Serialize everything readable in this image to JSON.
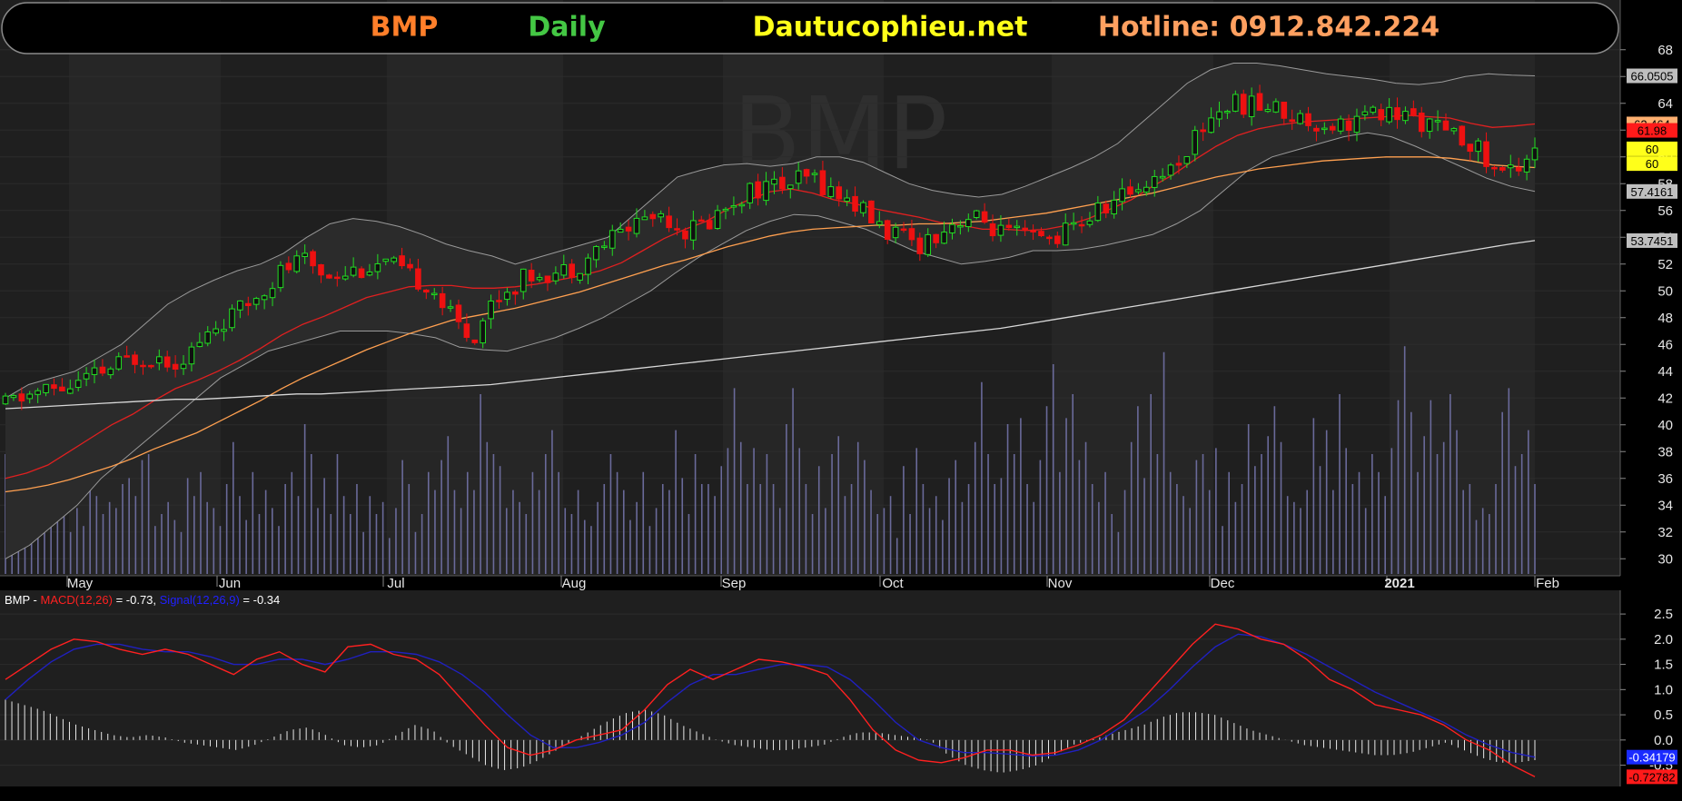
{
  "header": {
    "symbol": "BMP",
    "period": "Daily",
    "site": "Dautucophieu.net",
    "hotline": "Hotline: 0912.842.224",
    "colors": {
      "symbol": "#ff7f2a",
      "period": "#44c744",
      "site": "#ffff1a",
      "hotline": "#ffa060"
    }
  },
  "watermark": "BMP",
  "chart_data": [
    {
      "type": "candlestick",
      "title": "BMP",
      "y_ticks": [
        "30",
        "32",
        "34",
        "36",
        "38",
        "40",
        "42",
        "44",
        "46",
        "48",
        "50",
        "52",
        "54",
        "56",
        "58",
        "60",
        "62",
        "64",
        "66",
        "68"
      ],
      "ylim": [
        29,
        69
      ],
      "month_labels": [
        "May",
        "Jun",
        "Jul",
        "Aug",
        "Sep",
        "Oct",
        "Nov",
        "Dec",
        "2021",
        "Feb"
      ],
      "value_labels": [
        {
          "text": "66.0505",
          "value": 66.05,
          "bg": "#bfbfbf",
          "fg": "#000000"
        },
        {
          "text": "62.464",
          "value": 62.46,
          "bg": "#ffb070",
          "fg": "#000000"
        },
        {
          "text": "61.98",
          "value": 61.98,
          "bg": "#ff1a1a",
          "fg": "#000000"
        },
        {
          "text": "60",
          "value": 60.6,
          "bg": "#ffff1a",
          "fg": "#000000"
        },
        {
          "text": "60",
          "value": 59.5,
          "bg": "#ffff1a",
          "fg": "#000000"
        },
        {
          "text": "57.4161",
          "value": 57.42,
          "bg": "#bfbfbf",
          "fg": "#000000"
        },
        {
          "text": "53.7451",
          "value": 53.75,
          "bg": "#bfbfbf",
          "fg": "#000000"
        }
      ],
      "trend": [
        41.5,
        42.2,
        42.6,
        42.8,
        43.5,
        44.2,
        45.0,
        45.2,
        44.8,
        45.8,
        47.5,
        48.4,
        50.0,
        51.5,
        52.3,
        51.3,
        51.5,
        51.8,
        52.0,
        51.0,
        50.5,
        48.0,
        46.5,
        49.5,
        50.5,
        51.5,
        51.3,
        52.0,
        53.3,
        54.5,
        55.5,
        55.8,
        54.5,
        55.0,
        56.5,
        57.5,
        57.8,
        58.0,
        58.5,
        57.3,
        56.5,
        55.0,
        54.0,
        53.5,
        54.5,
        55.5,
        55.2,
        54.2,
        54.0,
        53.8,
        54.5,
        55.5,
        56.5,
        57.5,
        58.5,
        59.3,
        61.5,
        63.5,
        64.0,
        63.8,
        63.5,
        62.8,
        62.5,
        62.5,
        63.0,
        63.2,
        63.0,
        62.5,
        61.5,
        61.2,
        59.0,
        59.0,
        61.0
      ],
      "series": [
        {
          "name": "MA20",
          "color": "#e02020",
          "values": [
            36,
            36.4,
            37,
            38,
            39,
            40,
            40.8,
            41.8,
            42.7,
            43.3,
            44,
            44.8,
            45.7,
            46.7,
            47.5,
            48.1,
            48.8,
            49.5,
            49.9,
            50.3,
            50.4,
            50.4,
            50.2,
            50.2,
            50.3,
            50.5,
            50.8,
            51.1,
            51.5,
            52.1,
            53,
            53.9,
            54.6,
            55.2,
            56.1,
            56.8,
            57.4,
            57.6,
            57.3,
            56.8,
            56.5,
            56.1,
            55.8,
            55.5,
            55.1,
            54.9,
            54.6,
            54.6,
            54.5,
            54.6,
            54.9,
            55.4,
            56.1,
            56.8,
            57.8,
            58.7,
            59.8,
            60.8,
            61.6,
            62.1,
            62.4,
            62.6,
            62.7,
            62.8,
            62.9,
            63,
            63.1,
            63,
            62.9,
            62.5,
            62.2,
            62.3,
            62.46
          ]
        },
        {
          "name": "MA50",
          "color": "#ffa050",
          "values": [
            35,
            35.2,
            35.5,
            35.9,
            36.4,
            36.9,
            37.5,
            38.2,
            38.8,
            39.4,
            40.2,
            41,
            41.8,
            42.7,
            43.5,
            44.2,
            44.9,
            45.6,
            46.2,
            46.8,
            47.3,
            47.8,
            48.1,
            48.4,
            48.7,
            49.1,
            49.5,
            49.9,
            50.4,
            50.9,
            51.4,
            51.9,
            52.3,
            52.8,
            53.3,
            53.7,
            54.1,
            54.4,
            54.6,
            54.7,
            54.8,
            54.9,
            54.9,
            55,
            55,
            55.1,
            55.2,
            55.4,
            55.6,
            55.8,
            56.1,
            56.4,
            56.7,
            57,
            57.3,
            57.7,
            58.1,
            58.5,
            58.8,
            59.1,
            59.3,
            59.5,
            59.7,
            59.8,
            59.9,
            60,
            60,
            60,
            59.9,
            59.7,
            59.4,
            59.3,
            59.2
          ]
        },
        {
          "name": "MA200",
          "color": "#d8d8d8",
          "values": [
            41.2,
            41.3,
            41.4,
            41.5,
            41.6,
            41.7,
            41.8,
            41.9,
            41.9,
            42,
            42.1,
            42.2,
            42.3,
            42.3,
            42.4,
            42.5,
            42.6,
            42.7,
            42.8,
            42.9,
            43,
            43.2,
            43.4,
            43.6,
            43.8,
            44,
            44.2,
            44.4,
            44.6,
            44.8,
            45,
            45.2,
            45.4,
            45.6,
            45.8,
            46,
            46.2,
            46.4,
            46.6,
            46.8,
            47,
            47.2,
            47.5,
            47.8,
            48.1,
            48.4,
            48.7,
            49,
            49.3,
            49.6,
            49.9,
            50.2,
            50.5,
            50.8,
            51.1,
            51.4,
            51.7,
            52,
            52.3,
            52.6,
            52.9,
            53.2,
            53.5,
            53.75
          ]
        }
      ],
      "bollinger": {
        "color": "#9a9a9a",
        "upper": [
          42,
          43,
          43.5,
          44,
          45,
          46,
          47.5,
          49,
          50,
          50.8,
          51.5,
          52,
          52.8,
          54,
          55,
          55.4,
          55.2,
          54.8,
          54.2,
          53.5,
          53,
          52.6,
          52,
          52.5,
          53,
          53.5,
          54,
          55.5,
          57,
          58.5,
          59,
          59.4,
          59.5,
          59.3,
          59.5,
          60,
          60,
          59.6,
          58.8,
          58,
          57.5,
          57.2,
          57,
          57.2,
          57.8,
          58.5,
          59.2,
          60,
          61,
          62.5,
          64,
          65.5,
          66.5,
          67,
          67,
          66.8,
          66.5,
          66.2,
          66,
          65.8,
          65.5,
          65.4,
          65.6,
          66,
          66.2,
          66.1,
          66.05
        ],
        "lower": [
          30,
          31,
          32.5,
          34,
          36,
          37.5,
          39,
          40.5,
          42,
          43.5,
          44.5,
          45.5,
          46,
          46.5,
          47,
          47,
          47,
          46.8,
          46.5,
          45.8,
          45.6,
          45.5,
          46,
          46.5,
          47.2,
          48,
          49,
          50,
          51.3,
          52.5,
          53.5,
          54.5,
          55.2,
          55.7,
          55.6,
          55.1,
          54.6,
          53.8,
          53,
          52.5,
          52,
          52.2,
          52.5,
          53,
          53,
          53.1,
          53.4,
          53.8,
          54.2,
          55,
          56,
          57.5,
          59,
          60,
          60.5,
          61,
          61.5,
          61.8,
          61.5,
          60.8,
          60,
          59.2,
          58.4,
          57.8,
          57.42
        ]
      }
    },
    {
      "type": "bar",
      "title": "Volume",
      "ylim": [
        0,
        100
      ],
      "values": [
        40,
        22,
        38,
        30,
        18,
        26,
        36,
        30,
        42,
        28,
        14,
        22,
        16,
        30,
        26,
        20,
        24,
        22,
        30,
        32,
        26,
        38,
        40,
        16,
        20,
        24,
        18,
        14,
        32,
        26,
        34,
        24,
        22,
        16,
        30,
        44,
        26,
        18,
        34,
        20,
        28,
        22,
        16,
        30,
        34,
        26,
        50,
        40,
        22,
        32,
        20,
        40,
        26,
        20,
        30,
        14,
        26,
        20,
        24,
        12,
        22,
        38,
        30,
        14,
        20,
        34,
        28,
        38,
        46,
        28,
        22,
        34,
        28,
        60,
        44,
        40,
        36,
        22,
        28,
        24,
        20,
        34,
        28,
        40,
        48,
        34,
        22,
        20,
        28,
        18,
        16,
        24,
        30,
        40,
        34,
        28,
        18,
        24,
        34,
        16,
        22,
        30,
        28,
        48,
        32,
        20,
        40,
        30,
        30,
        26,
        36,
        42,
        62,
        44,
        30,
        42,
        30,
        40,
        30,
        22,
        50,
        62,
        42,
        30,
        20,
        36,
        22,
        40,
        46,
        26,
        30,
        44,
        38,
        28,
        20,
        22,
        26,
        12,
        36,
        20,
        42,
        30,
        22,
        26,
        18,
        32,
        38,
        24,
        30,
        44,
        64,
        40,
        30,
        32,
        50,
        40,
        52,
        30,
        24,
        38,
        56,
        70,
        34,
        52,
        60,
        38,
        44,
        30,
        24,
        34,
        20,
        14,
        28,
        44,
        56,
        32,
        60,
        40,
        74,
        34,
        30,
        26,
        22,
        38,
        40,
        28,
        42,
        16,
        34,
        24,
        30,
        50,
        36,
        40,
        46,
        56,
        44,
        26,
        24,
        22,
        28,
        52,
        36,
        48,
        28,
        60,
        42,
        30,
        34,
        22,
        40,
        34,
        26,
        42,
        58,
        76,
        54,
        34,
        46,
        58,
        40,
        44,
        60,
        48,
        28,
        30,
        18,
        22,
        20,
        30,
        54,
        62,
        36,
        40,
        48,
        30
      ]
    },
    {
      "type": "line",
      "title": "MACD",
      "legend": {
        "prefix": "BMP - ",
        "macd_label": "MACD(12,26)",
        "macd_value": " = -0.73, ",
        "signal_label": "Signal(12,26,9)",
        "signal_value": " = -0.34"
      },
      "y_ticks": [
        "2.5",
        "2.0",
        "1.5",
        "1.0",
        "0.5",
        "0.0",
        "-0.5"
      ],
      "ylim": [
        -0.85,
        2.7
      ],
      "value_labels": [
        {
          "text": "-0.34179",
          "value": -0.34,
          "bg": "#1a2bff",
          "fg": "#ffffff"
        },
        {
          "text": "-0.72782",
          "value": -0.73,
          "bg": "#ff1a1a",
          "fg": "#000000"
        }
      ],
      "series": [
        {
          "name": "MACD",
          "color": "#ff2020",
          "values": [
            1.2,
            1.5,
            1.8,
            2.0,
            1.95,
            1.8,
            1.7,
            1.8,
            1.7,
            1.5,
            1.3,
            1.6,
            1.75,
            1.5,
            1.35,
            1.85,
            1.9,
            1.7,
            1.6,
            1.3,
            0.8,
            0.3,
            -0.15,
            -0.3,
            -0.2,
            0.0,
            0.1,
            0.2,
            0.6,
            1.1,
            1.4,
            1.2,
            1.4,
            1.6,
            1.55,
            1.45,
            1.3,
            0.8,
            0.2,
            -0.2,
            -0.4,
            -0.45,
            -0.35,
            -0.2,
            -0.2,
            -0.3,
            -0.25,
            -0.1,
            0.1,
            0.4,
            0.9,
            1.4,
            1.9,
            2.3,
            2.2,
            2.0,
            1.9,
            1.6,
            1.2,
            1.0,
            0.7,
            0.6,
            0.5,
            0.3,
            0.0,
            -0.2,
            -0.5,
            -0.73
          ]
        },
        {
          "name": "Signal",
          "color": "#2020c0",
          "values": [
            0.8,
            1.2,
            1.55,
            1.8,
            1.9,
            1.9,
            1.8,
            1.75,
            1.75,
            1.65,
            1.5,
            1.5,
            1.6,
            1.6,
            1.5,
            1.6,
            1.75,
            1.75,
            1.7,
            1.55,
            1.3,
            0.95,
            0.5,
            0.1,
            -0.15,
            -0.15,
            -0.05,
            0.1,
            0.35,
            0.75,
            1.1,
            1.3,
            1.3,
            1.4,
            1.5,
            1.5,
            1.45,
            1.2,
            0.8,
            0.35,
            0.0,
            -0.15,
            -0.25,
            -0.25,
            -0.28,
            -0.32,
            -0.3,
            -0.2,
            0.0,
            0.3,
            0.6,
            1.0,
            1.45,
            1.85,
            2.1,
            2.05,
            1.9,
            1.7,
            1.45,
            1.2,
            0.95,
            0.75,
            0.55,
            0.35,
            0.1,
            -0.1,
            -0.25,
            -0.34
          ]
        },
        {
          "name": "Histogram",
          "color": "#e8e8e8",
          "values": [
            0.8,
            0.7,
            0.6,
            0.45,
            0.3,
            0.2,
            0.1,
            0.05,
            0.1,
            0.05,
            -0.05,
            -0.1,
            -0.15,
            -0.2,
            -0.1,
            0.05,
            0.2,
            0.25,
            0.1,
            -0.1,
            -0.15,
            -0.1,
            0.1,
            0.3,
            0.2,
            -0.1,
            -0.3,
            -0.5,
            -0.6,
            -0.55,
            -0.4,
            -0.2,
            0.0,
            0.2,
            0.4,
            0.55,
            0.6,
            0.5,
            0.3,
            0.15,
            0.0,
            -0.1,
            -0.15,
            -0.2,
            -0.2,
            -0.15,
            -0.1,
            0.05,
            0.15,
            0.15,
            0.1,
            0.05,
            0.0,
            -0.3,
            -0.5,
            -0.6,
            -0.65,
            -0.6,
            -0.5,
            -0.3,
            -0.1,
            0.0,
            0.1,
            0.2,
            0.3,
            0.45,
            0.55,
            0.55,
            0.5,
            0.35,
            0.2,
            0.1,
            0.0,
            -0.1,
            -0.15,
            -0.2,
            -0.25,
            -0.3,
            -0.3,
            -0.25,
            -0.15,
            -0.05,
            -0.2,
            -0.35,
            -0.45,
            -0.45,
            -0.4
          ]
        }
      ]
    }
  ]
}
